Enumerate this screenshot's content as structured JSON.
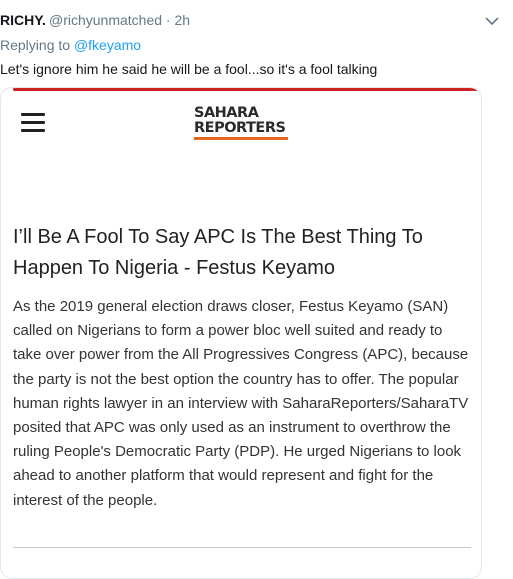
{
  "tweet": {
    "author_name": "RICHY.",
    "author_handle": "@richyunmatched · 2h",
    "replying_to_prefix": "Replying to",
    "replying_to_handle": "@fkeyamo",
    "text": "Let's ignore him he said he will be a fool...so it's a fool talking"
  },
  "icons": {
    "menu": "hamburger-menu-icon",
    "more": "chevron-down-icon"
  },
  "colors": {
    "link": "#1da1f2",
    "accent_red": "#cc2222",
    "logo_orange": "#e2661e"
  },
  "card": {
    "logo_line1": "SAHARA",
    "logo_line2": "REPORTERS",
    "title": "I’ll Be A Fool To Say APC Is The Best Thing To Happen To Nigeria - Festus Keyamo",
    "body": "As the 2019 general election draws closer, Festus Keyamo (SAN) called on Nigerians to form a power bloc well suited and ready to take over power from the All Progressives Congress (APC), because the party is not the best option the country has to offer. The popular human rights lawyer in an interview with SaharaReporters/SaharaTV posited that APC was only used as an instrument to overthrow the ruling People's Democratic Party (PDP). He urged Nigerians to look ahead to another platform that would represent and fight for the interest of the people."
  }
}
